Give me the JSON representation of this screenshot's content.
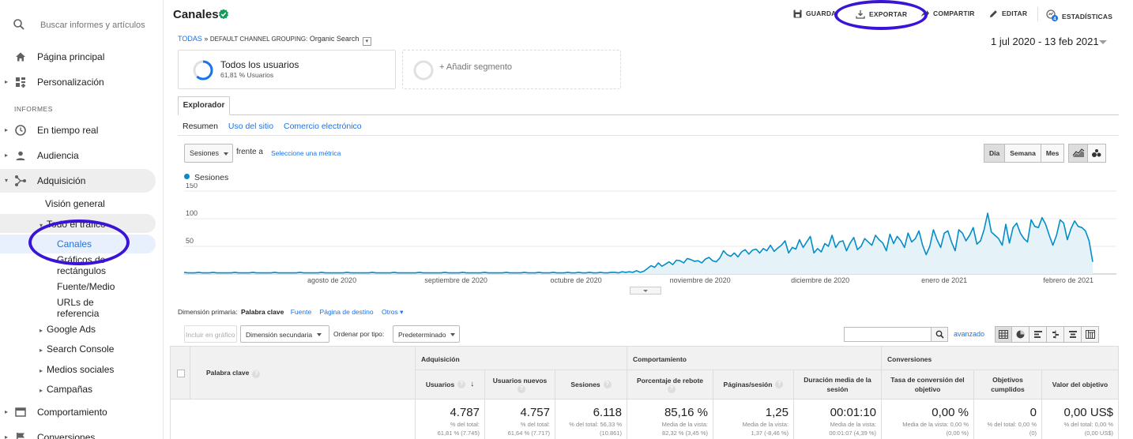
{
  "sidebar": {
    "search_placeholder": "Buscar informes y artículos",
    "home": "Página principal",
    "custom": "Personalización",
    "section": "INFORMES",
    "realtime": "En tiempo real",
    "audience": "Audiencia",
    "acquisition": "Adquisición",
    "overview": "Visión general",
    "all_traffic": "Todo el tráfico",
    "channels": "Canales",
    "treemaps_line1": "Gráficos de",
    "treemaps_line2": "rectángulos",
    "source_medium": "Fuente/Medio",
    "referrals_line1": "URLs de",
    "referrals_line2": "referencia",
    "google_ads": "Google Ads",
    "search_console": "Search Console",
    "social": "Medios sociales",
    "campaigns": "Campañas",
    "behavior": "Comportamiento",
    "conversions": "Conversiones"
  },
  "header": {
    "title": "Canales",
    "save": "GUARDAR",
    "export": "EXPORTAR",
    "share": "COMPARTIR",
    "edit": "EDITAR",
    "insights": "ESTADÍSTICAS",
    "insights_badge": "4"
  },
  "breadcrumb": {
    "all": "TODAS",
    "sep": "»",
    "grouping": "DEFAULT CHANNEL GROUPING:",
    "value": "Organic Search"
  },
  "date_range": "1 jul 2020 - 13 feb 2021",
  "segments": {
    "all_users": "Todos los usuarios",
    "all_users_pct": "61,81 % Usuarios",
    "all_users_fraction": 0.6181,
    "add": "+ Añadir segmento"
  },
  "explorer": {
    "tab": "Explorador",
    "subtabs": [
      "Resumen",
      "Uso del sitio",
      "Comercio electrónico"
    ]
  },
  "chart_controls": {
    "metric": "Sesiones",
    "vs": "frente a",
    "choose": "Seleccione una métrica",
    "periods": [
      "Día",
      "Semana",
      "Mes"
    ]
  },
  "chart_data": {
    "type": "line",
    "series": [
      {
        "name": "Sesiones",
        "color": "#058dc7"
      }
    ],
    "y_ticks": [
      "150",
      "100",
      "50"
    ],
    "ylim": [
      0,
      150
    ],
    "x_labels": [
      "agosto de 2020",
      "septiembre de 2020",
      "octubre de 2020",
      "noviembre de 2020",
      "diciembre de 2020",
      "enero de 2021",
      "febrero de 2021"
    ],
    "x_start": "2020-07-01",
    "x_end": "2021-02-13",
    "grid": true,
    "values": [
      3,
      2,
      2,
      2,
      3,
      2,
      2,
      2,
      3,
      2,
      2,
      2,
      2,
      2,
      3,
      2,
      2,
      2,
      2,
      3,
      2,
      2,
      2,
      2,
      2,
      3,
      2,
      2,
      2,
      2,
      2,
      2,
      3,
      2,
      2,
      2,
      2,
      2,
      3,
      2,
      2,
      2,
      2,
      2,
      2,
      3,
      2,
      2,
      2,
      2,
      2,
      2,
      3,
      2,
      2,
      2,
      2,
      2,
      3,
      2,
      2,
      2,
      2,
      2,
      2,
      3,
      2,
      2,
      2,
      2,
      2,
      2,
      3,
      2,
      2,
      2,
      2,
      3,
      2,
      2,
      2,
      2,
      2,
      3,
      2,
      2,
      2,
      2,
      2,
      3,
      2,
      2,
      2,
      2,
      3,
      2,
      2,
      2,
      3,
      2,
      2,
      2,
      3,
      2,
      2,
      2,
      3,
      2,
      2,
      3,
      2,
      2,
      3,
      2,
      2,
      3,
      2,
      2,
      3,
      3,
      2,
      4,
      3,
      4,
      3,
      6,
      3,
      5,
      10,
      15,
      12,
      20,
      14,
      18,
      22,
      17,
      25,
      24,
      20,
      28,
      26,
      23,
      24,
      20,
      27,
      30,
      24,
      22,
      29,
      42,
      35,
      32,
      38,
      31,
      40,
      44,
      36,
      43,
      45,
      38,
      46,
      42,
      52,
      41,
      47,
      52,
      60,
      38,
      48,
      45,
      62,
      48,
      58,
      68,
      38,
      46,
      40,
      55,
      50,
      70,
      48,
      58,
      60,
      42,
      56,
      66,
      44,
      50,
      64,
      58,
      52,
      70,
      62,
      56,
      42,
      72,
      55,
      68,
      60,
      48,
      74,
      58,
      64,
      78,
      52,
      35,
      50,
      80,
      62,
      48,
      74,
      78,
      58,
      42,
      80,
      74,
      60,
      70,
      84,
      54,
      60,
      80,
      110,
      76,
      70,
      64,
      52,
      90,
      56,
      84,
      92,
      74,
      64,
      58,
      98,
      86,
      84,
      102,
      90,
      70,
      52,
      70,
      98,
      92,
      62,
      82,
      96,
      86,
      84,
      78,
      60,
      22
    ]
  },
  "table_controls": {
    "primary_label": "Dimensión primaria:",
    "primary_current": "Palabra clave",
    "dims": [
      "Fuente",
      "Página de destino",
      "Otros"
    ],
    "plot_rows": "Incluir en gráfico",
    "secondary": "Dimensión secundaria",
    "order_label": "Ordenar por tipo:",
    "order_value": "Predeterminado",
    "advanced": "avanzado"
  },
  "table": {
    "dimension_header": "Palabra clave",
    "groups": [
      "Adquisición",
      "Comportamiento",
      "Conversiones"
    ],
    "columns": [
      "Usuarios",
      "Usuarios nuevos",
      "Sesiones",
      "Porcentaje de rebote",
      "Páginas/sesión",
      "Duración media de la sesión",
      "Tasa de conversión del objetivo",
      "Objetivos cumplidos",
      "Valor del objetivo"
    ],
    "totals": [
      {
        "v": "4.787",
        "s1": "% del total:",
        "s2": "61,81 % (7.745)"
      },
      {
        "v": "4.757",
        "s1": "% del total:",
        "s2": "61,64 % (7.717)"
      },
      {
        "v": "6.118",
        "s1": "% del total: 56,33 %",
        "s2": "(10.861)"
      },
      {
        "v": "85,16 %",
        "s1": "Media de la vista:",
        "s2": "82,32 % (3,45 %)"
      },
      {
        "v": "1,25",
        "s1": "Media de la vista:",
        "s2": "1,37 (-8,46 %)"
      },
      {
        "v": "00:01:10",
        "s1": "Media de la vista:",
        "s2": "00:01:07 (4,39 %)"
      },
      {
        "v": "0,00 %",
        "s1": "Media de la vista: 0,00 %",
        "s2": "(0,00 %)"
      },
      {
        "v": "0",
        "s1": "% del total: 0,00 %",
        "s2": "(0)"
      },
      {
        "v": "0,00 US$",
        "s1": "% del total: 0,00 %",
        "s2": "(0,00 US$)"
      }
    ]
  },
  "colors": {
    "accent": "#1a73e8",
    "series": "#058dc7",
    "annotation": "#3914d6",
    "verified": "#0f9d58"
  }
}
